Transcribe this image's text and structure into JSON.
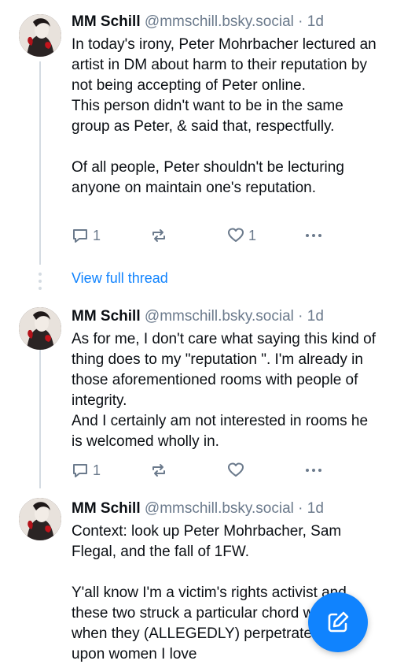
{
  "posts": [
    {
      "author": "MM Schill",
      "handle": "@mmschill.bsky.social",
      "separator": "·",
      "time": "1d",
      "text": "In today's irony, Peter Mohrbacher lectured an artist in DM about harm to their reputation by not being accepting of Peter online.\nThis person didn't want to be in the same group as Peter, & said that, respectfully.\n\nOf all people, Peter shouldn't be lecturing anyone on maintain one's reputation.",
      "reply_count": "1",
      "like_count": "1"
    },
    {
      "author": "MM Schill",
      "handle": "@mmschill.bsky.social",
      "separator": "·",
      "time": "1d",
      "text": "As for me, I don't care what saying this kind of thing does to my \"reputation \". I'm already in those aforementioned rooms with people of integrity.\nAnd I certainly am not interested in rooms he is welcomed wholly in.",
      "reply_count": "1",
      "like_count": ""
    },
    {
      "author": "MM Schill",
      "handle": "@mmschill.bsky.social",
      "separator": "·",
      "time": "1d",
      "text": "Context: look up Peter Mohrbacher, Sam Flegal, and the fall of 1FW.\n\nY'all know I'm a victim's rights activist and these two struck a particular chord with me when they (ALLEGEDLY) perpetrated harm upon women I love"
    }
  ],
  "view_full_thread": "View full thread",
  "icons": {
    "reply": "reply-icon",
    "repost": "repost-icon",
    "like": "heart-icon",
    "more": "more-icon",
    "compose": "compose-icon"
  },
  "colors": {
    "accent": "#1083fe",
    "muted": "#6b7a8c",
    "thread_line": "#d4dbe2"
  }
}
